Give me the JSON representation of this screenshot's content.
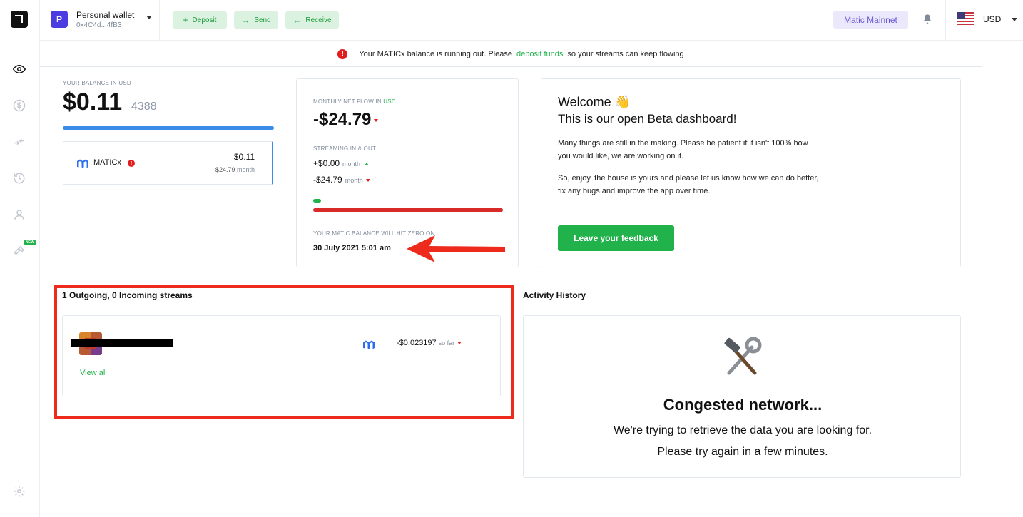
{
  "wallet": {
    "avatar_letter": "P",
    "name": "Personal wallet",
    "address": "0x4C4d...4fB3"
  },
  "actions": {
    "deposit": "Deposit",
    "send": "Send",
    "receive": "Receive"
  },
  "network": "Matic Mainnet",
  "currency": "USD",
  "alert": {
    "before": "Your MATICx balance is running out. Please",
    "link": "deposit funds",
    "after": "so your streams can keep flowing"
  },
  "balance": {
    "label": "YOUR BALANCE IN USD",
    "main": "$0.11",
    "fraction": "4388",
    "token": {
      "name": "MATICx",
      "value": "$0.11",
      "rate": "-$24.79",
      "rate_unit": "month"
    }
  },
  "flow": {
    "label_prefix": "MONTHLY NET FLOW IN",
    "label_currency": "USD",
    "net": "-$24.79",
    "stream_label": "STREAMING IN & OUT",
    "in_value": "+$0.00",
    "out_value": "-$24.79",
    "unit": "month",
    "zero_label": "YOUR MATIC BALANCE WILL HIT ZERO ON",
    "zero_date": "30 July 2021 5:01 am"
  },
  "welcome": {
    "title": "Welcome",
    "emoji": "👋",
    "subtitle": "This is our open Beta dashboard!",
    "p1": "Many things are still in the making. Please be patient if it isn't 100% how you would like, we are working on it.",
    "p2": "So, enjoy, the house is yours and please let us know how we can do better, fix any bugs and improve the app over time.",
    "button": "Leave your feedback"
  },
  "streams": {
    "title": "1 Outgoing, 0 Incoming streams",
    "amount": "-$0.023197",
    "amount_unit": "so far",
    "view_all": "View all"
  },
  "activity": {
    "title": "Activity History",
    "status": "Congested network...",
    "line1": "We're trying to retrieve the data you are looking for.",
    "line2": "Please try again in a few minutes."
  },
  "sidebar": {
    "new_badge": "NEW"
  },
  "colors": {
    "accent_green": "#22b24c",
    "error_red": "#e01e1e",
    "balance_blue": "#3b8be8",
    "network_purple": "#6b5ad8"
  }
}
